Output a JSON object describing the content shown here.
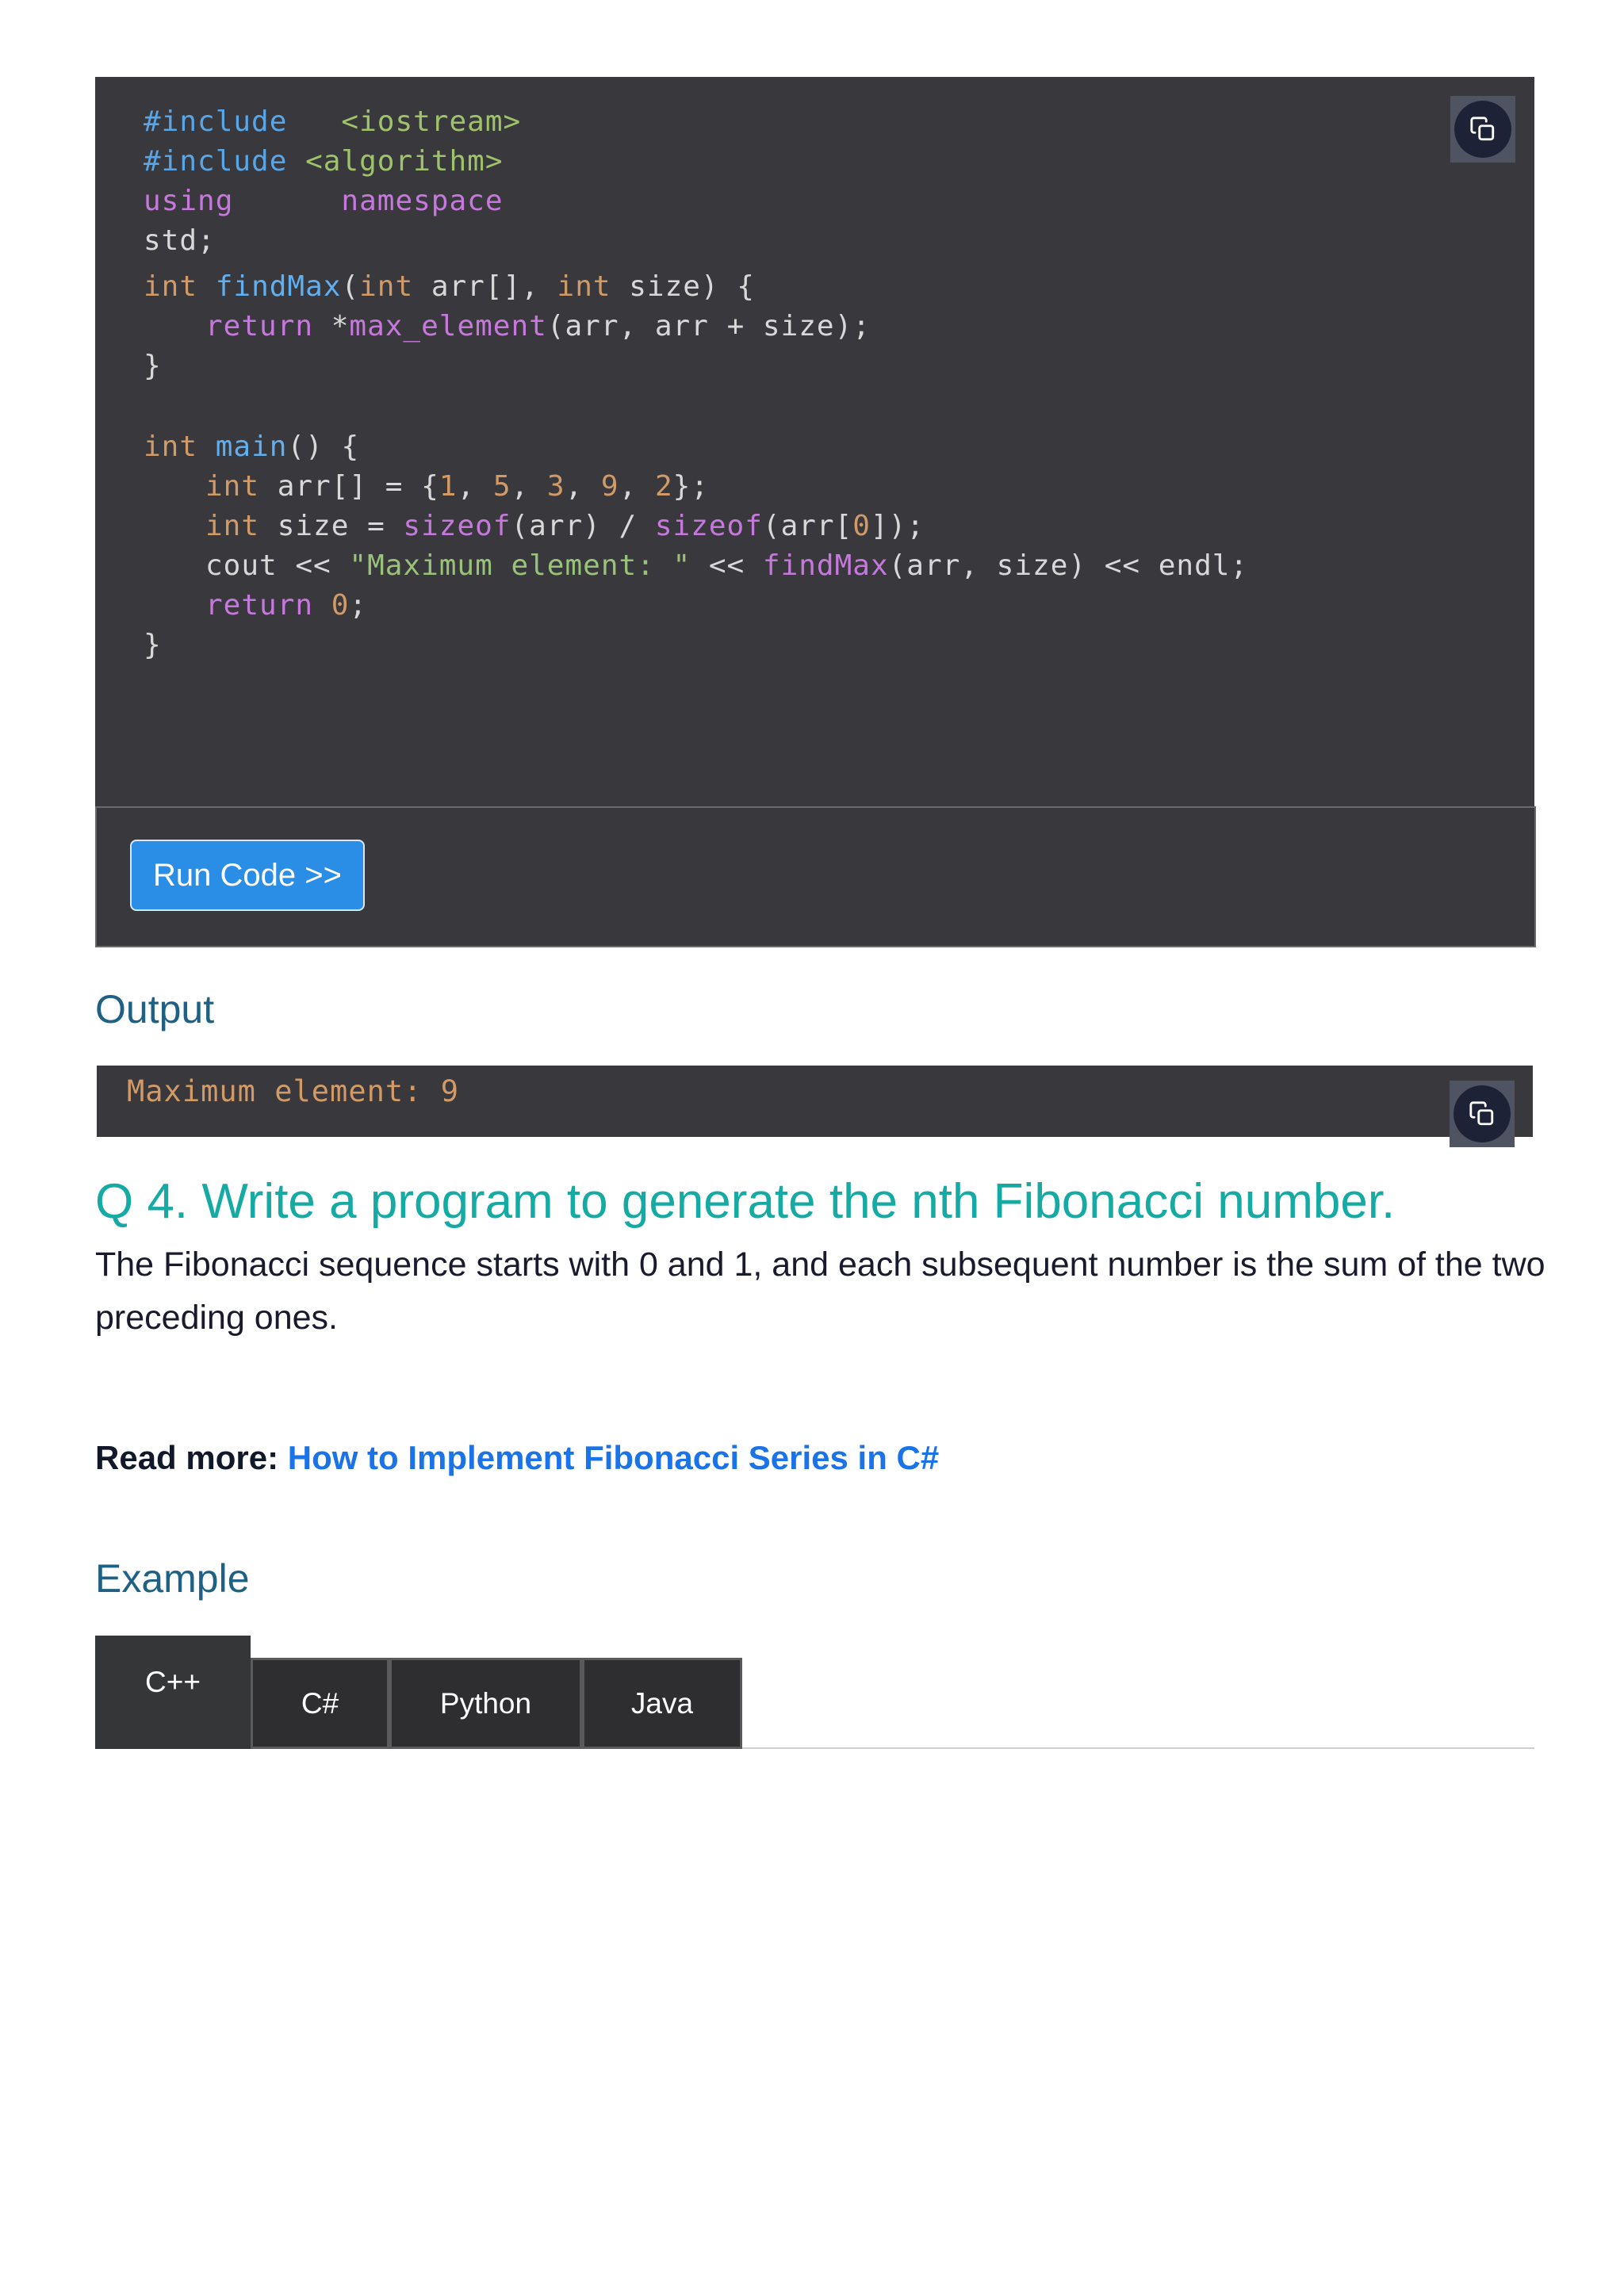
{
  "code": {
    "lines": {
      "l1_pp": "#include",
      "l1_str": "<iostream>",
      "l2_pp": "#include",
      "l2_str": "<algorithm>",
      "l3_kw": "using",
      "l3_ns": "namespace",
      "l4": "std;",
      "l5_type": "int",
      "l5_fn": "findMax",
      "l5_p1": "(",
      "l5_t2": "int",
      "l5_p2": " arr[], ",
      "l5_t3": "int",
      "l5_p3": " size) {",
      "l6_kw": "return",
      "l6_p1": " *",
      "l6_fn": "max_element",
      "l6_p2": "(arr, arr + size);",
      "l7": "}",
      "l8_type": "int",
      "l8_fn": "main",
      "l8_p": "() {",
      "l9_type": "int",
      "l9_p1": " arr[] = {",
      "l9_n1": "1",
      "l9_c1": ", ",
      "l9_n2": "5",
      "l9_c2": ", ",
      "l9_n3": "3",
      "l9_c3": ", ",
      "l9_n4": "9",
      "l9_c4": ", ",
      "l9_n5": "2",
      "l9_p2": "};",
      "l10_type": "int",
      "l10_p1": " size = ",
      "l10_fn1": "sizeof",
      "l10_p2": "(arr) / ",
      "l10_fn2": "sizeof",
      "l10_p3": "(arr[",
      "l10_n": "0",
      "l10_p4": "]);",
      "l11_p1": "cout << ",
      "l11_str": "\"Maximum element: \"",
      "l11_p2": " << ",
      "l11_fn": "findMax",
      "l11_p3": "(arr, size) << endl;",
      "l12_kw": "return",
      "l12_sp": " ",
      "l12_n": "0",
      "l12_p": ";",
      "l13": "}"
    }
  },
  "run_button": {
    "label": "Run Code >>"
  },
  "output": {
    "heading": "Output",
    "text_a": "Maximum",
    "text_b": " element: 9"
  },
  "question": {
    "title": "Q 4. Write a program to generate the nth Fibonacci number.",
    "description": "The Fibonacci sequence starts with 0 and 1, and each subsequent number is the sum of the two preceding ones."
  },
  "read_more": {
    "label": "Read more:",
    "link_text": "How to Implement Fibonacci Series in C#"
  },
  "example": {
    "heading": "Example",
    "tabs": [
      {
        "label": "C++"
      },
      {
        "label": "C#"
      },
      {
        "label": "Python"
      },
      {
        "label": "Java"
      }
    ]
  },
  "icons": {
    "copy": "copy-icon"
  }
}
